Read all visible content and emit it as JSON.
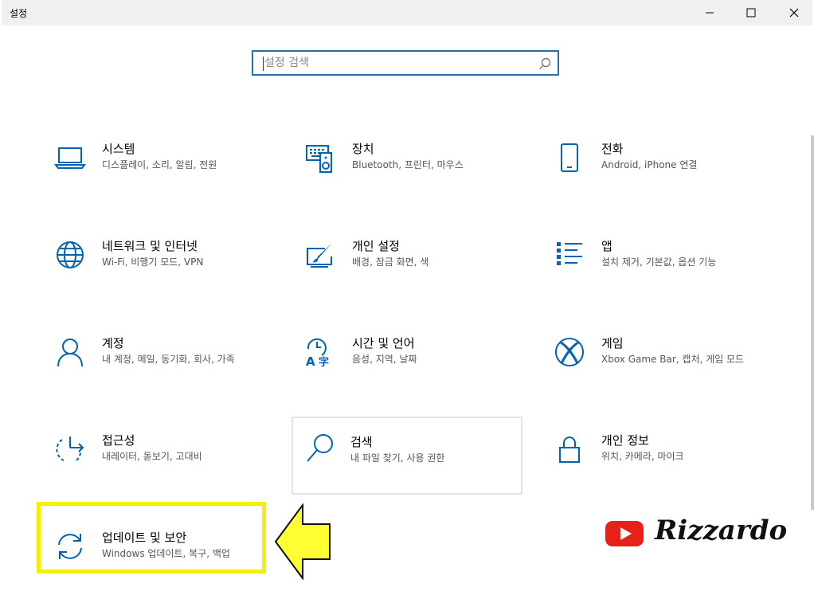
{
  "window": {
    "title": "설정"
  },
  "search": {
    "placeholder": "설정 검색"
  },
  "colors": {
    "accent": "#0063b1",
    "highlight": "#f5f000",
    "youtube": "#e62117"
  },
  "tiles": [
    {
      "name": "시스템",
      "desc": "디스플레이, 소리, 알림, 전원",
      "icon": "laptop-icon"
    },
    {
      "name": "장치",
      "desc": "Bluetooth, 프린터, 마우스",
      "icon": "keyboard-speaker-icon"
    },
    {
      "name": "전화",
      "desc": "Android, iPhone 연결",
      "icon": "phone-icon"
    },
    {
      "name": "네트워크 및 인터넷",
      "desc": "Wi-Fi, 비행기 모드, VPN",
      "icon": "globe-icon"
    },
    {
      "name": "개인 설정",
      "desc": "배경, 잠금 화면, 색",
      "icon": "paint-icon"
    },
    {
      "name": "앱",
      "desc": "설치 제거, 기본값, 옵션 기능",
      "icon": "apps-list-icon"
    },
    {
      "name": "계정",
      "desc": "내 계정, 메일, 동기화, 회사, 가족",
      "icon": "person-icon"
    },
    {
      "name": "시간 및 언어",
      "desc": "음성, 지역, 날짜",
      "icon": "time-language-icon"
    },
    {
      "name": "게임",
      "desc": "Xbox Game Bar, 캡처, 게임 모드",
      "icon": "xbox-icon"
    },
    {
      "name": "접근성",
      "desc": "내레이터, 돋보기, 고대비",
      "icon": "accessibility-icon"
    },
    {
      "name": "검색",
      "desc": "내 파일 찾기, 사용 권한",
      "icon": "search-icon"
    },
    {
      "name": "개인 정보",
      "desc": "위치, 카메라, 마이크",
      "icon": "lock-icon"
    },
    {
      "name": "업데이트 및 보안",
      "desc": "Windows 업데이트, 복구, 백업",
      "icon": "sync-icon"
    }
  ],
  "watermark": {
    "text": "Rizzardo",
    "icon": "youtube-icon"
  }
}
